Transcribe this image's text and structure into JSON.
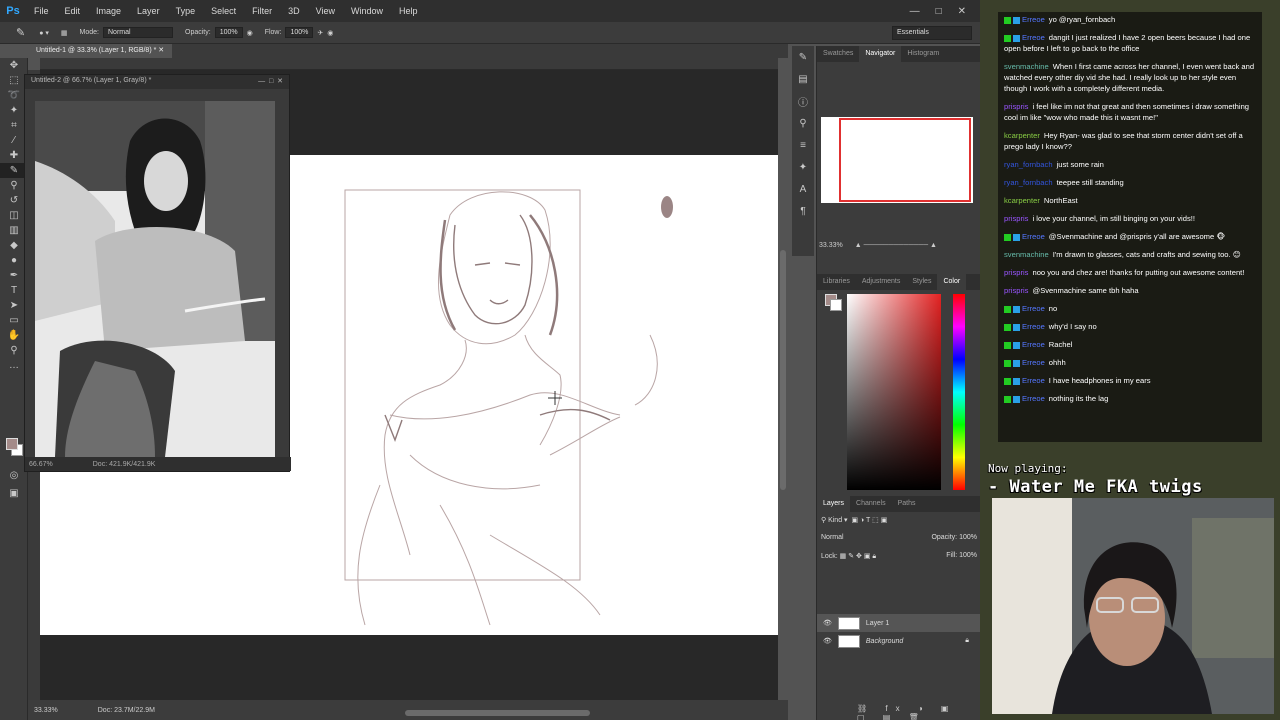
{
  "app": {
    "logo": "Ps",
    "accent": "#31a8ff"
  },
  "menu": [
    "File",
    "Edit",
    "Image",
    "Layer",
    "Type",
    "Select",
    "Filter",
    "3D",
    "View",
    "Window",
    "Help"
  ],
  "window_controls": [
    "—",
    "□",
    "✕"
  ],
  "options": {
    "mode_label": "Mode:",
    "mode_value": "Normal",
    "opacity_label": "Opacity:",
    "opacity_value": "100%",
    "flow_label": "Flow:",
    "flow_value": "100%",
    "workspace": "Essentials"
  },
  "doc_tab": "Untitled-1 @ 33.3% (Layer 1, RGB/8) *",
  "ref_window": {
    "title": "Untitled-2 @ 66.7% (Layer 1, Gray/8) *",
    "zoom": "66.67%",
    "doc": "Doc: 421.9K/421.9K"
  },
  "status": {
    "zoom": "33.33%",
    "doc": "Doc: 23.7M/22.9M"
  },
  "nav": {
    "tabs": [
      "Swatches",
      "Navigator",
      "Histogram"
    ],
    "active_tab": "Navigator",
    "zoom": "33.33%"
  },
  "color_tabs": [
    "Libraries",
    "Adjustments",
    "Styles",
    "Color"
  ],
  "layers": {
    "tabs": [
      "Layers",
      "Channels",
      "Paths"
    ],
    "kind": "Kind",
    "blend": "Normal",
    "opacity_label": "Opacity:",
    "opacity_value": "100%",
    "lock_label": "Lock:",
    "fill_label": "Fill:",
    "fill_value": "100%",
    "items": [
      {
        "name": "Layer 1",
        "selected": true
      },
      {
        "name": "Background",
        "selected": false
      }
    ]
  },
  "chat": [
    {
      "user": "Erreoe",
      "color": "#5577ff",
      "badges": true,
      "text": "yo @ryan_fornbach"
    },
    {
      "user": "Erreoe",
      "color": "#5577ff",
      "badges": true,
      "text": "dangit I just realized I have 2 open beers because I had one open before I left to go back to the office"
    },
    {
      "user": "svenmachine",
      "color": "#66bbaa",
      "badges": false,
      "text": "When I first came across her channel, I even went back and watched every other diy vid she had. I really look up to her style even though I work with a completely different media."
    },
    {
      "user": "prispris",
      "color": "#9955ff",
      "badges": false,
      "text": "i feel like im not that great and then sometimes i draw something cool im like \"wow who made this it wasnt me!\""
    },
    {
      "user": "kcarpenter",
      "color": "#88cc44",
      "badges": false,
      "text": "Hey Ryan- was glad to see that storm center didn't set off a prego lady I know??"
    },
    {
      "user": "ryan_fornbach",
      "color": "#3355dd",
      "badges": false,
      "text": "just some rain"
    },
    {
      "user": "ryan_fornbach",
      "color": "#3355dd",
      "badges": false,
      "text": "teepee still standing"
    },
    {
      "user": "kcarpenter",
      "color": "#88cc44",
      "badges": false,
      "text": "NorthEast"
    },
    {
      "user": "prispris",
      "color": "#9955ff",
      "badges": false,
      "text": "i love your channel, im still binging on your vids!!"
    },
    {
      "user": "Erreoe",
      "color": "#5577ff",
      "badges": true,
      "text": "@Svenmachine and @prispris y'all are awesome 🐵"
    },
    {
      "user": "svenmachine",
      "color": "#66bbaa",
      "badges": false,
      "text": "I'm drawn to glasses, cats and crafts and sewing too. 😊"
    },
    {
      "user": "prispris",
      "color": "#9955ff",
      "badges": false,
      "text": "noo you and chez are! thanks for putting out awesome content!"
    },
    {
      "user": "prispris",
      "color": "#9955ff",
      "badges": false,
      "text": "@Svenmachine same tbh haha"
    },
    {
      "user": "Erreoe",
      "color": "#5577ff",
      "badges": true,
      "text": "no"
    },
    {
      "user": "Erreoe",
      "color": "#5577ff",
      "badges": true,
      "text": "why'd I say no"
    },
    {
      "user": "Erreoe",
      "color": "#5577ff",
      "badges": true,
      "text": "Rachel"
    },
    {
      "user": "Erreoe",
      "color": "#5577ff",
      "badges": true,
      "text": "ohhh"
    },
    {
      "user": "Erreoe",
      "color": "#5577ff",
      "badges": true,
      "text": "I have headphones in my ears"
    },
    {
      "user": "Erreoe",
      "color": "#5577ff",
      "badges": true,
      "text": "nothing its the lag"
    }
  ],
  "now_playing": {
    "label": "Now playing:",
    "song": "- Water Me FKA twigs"
  }
}
